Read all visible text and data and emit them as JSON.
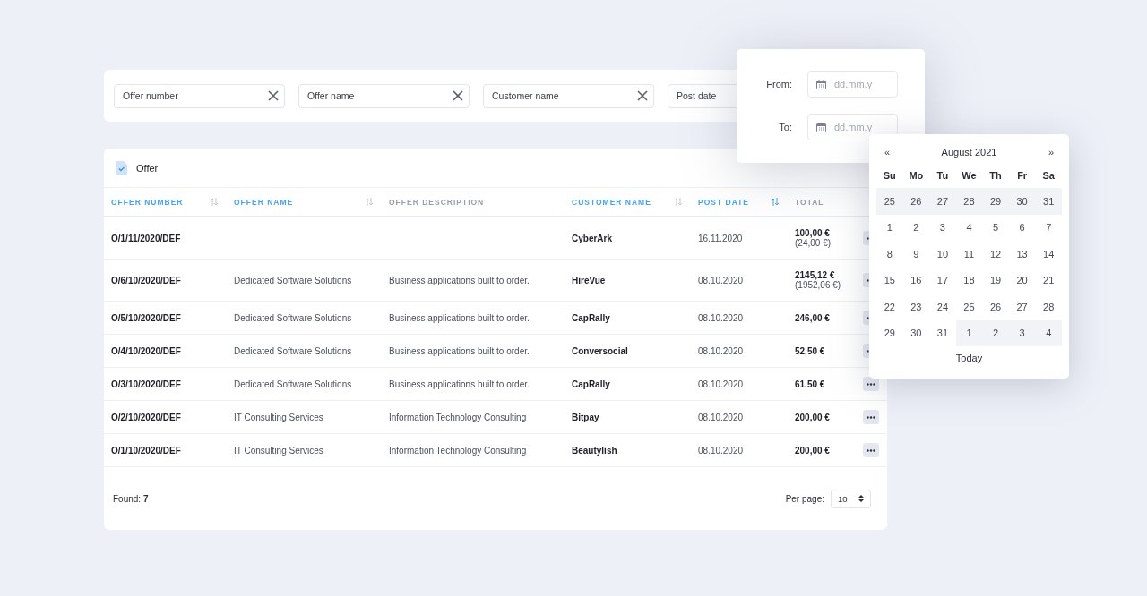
{
  "filters": [
    {
      "kind": "text",
      "placeholder": "Offer number"
    },
    {
      "kind": "text",
      "placeholder": "Offer name"
    },
    {
      "kind": "text",
      "placeholder": "Customer name"
    },
    {
      "kind": "date",
      "placeholder": "Post date"
    }
  ],
  "table": {
    "title": "Offer",
    "columns": [
      {
        "label": "OFFER NUMBER",
        "sortable": true,
        "sorted": false
      },
      {
        "label": "OFFER NAME",
        "sortable": true,
        "sorted": false
      },
      {
        "label": "OFFER DESCRIPTION",
        "sortable": false,
        "sorted": false
      },
      {
        "label": "CUSTOMER NAME",
        "sortable": true,
        "sorted": false
      },
      {
        "label": "POST DATE",
        "sortable": true,
        "sorted": true
      },
      {
        "label": "TOTAL",
        "sortable": false,
        "sorted": false
      }
    ],
    "rows": [
      {
        "number": "O/1/11/2020/DEF",
        "name": "",
        "description": "",
        "customer": "CyberArk",
        "date": "16.11.2020",
        "total": "100,00 €",
        "total_note": "(24,00 €)"
      },
      {
        "number": "O/6/10/2020/DEF",
        "name": "Dedicated Software Solutions",
        "description": "Business applications built to order.",
        "customer": "HireVue",
        "date": "08.10.2020",
        "total": "2145,12 €",
        "total_note": "(1952,06 €)"
      },
      {
        "number": "O/5/10/2020/DEF",
        "name": "Dedicated Software Solutions",
        "description": "Business applications built to order.",
        "customer": "CapRally",
        "date": "08.10.2020",
        "total": "246,00 €"
      },
      {
        "number": "O/4/10/2020/DEF",
        "name": "Dedicated Software Solutions",
        "description": "Business applications built to order.",
        "customer": "Conversocial",
        "date": "08.10.2020",
        "total": "52,50 €"
      },
      {
        "number": "O/3/10/2020/DEF",
        "name": "Dedicated Software Solutions",
        "description": "Business applications built to order.",
        "customer": "CapRally",
        "date": "08.10.2020",
        "total": "61,50 €"
      },
      {
        "number": "O/2/10/2020/DEF",
        "name": "IT Consulting Services",
        "description": "Information Technology Consulting",
        "customer": "Bitpay",
        "date": "08.10.2020",
        "total": "200,00 €"
      },
      {
        "number": "O/1/10/2020/DEF",
        "name": "IT Consulting Services",
        "description": "Information Technology Consulting",
        "customer": "Beautylish",
        "date": "08.10.2020",
        "total": "200,00 €"
      }
    ],
    "found": "Found: **7**",
    "per_page_label": "Per page:",
    "per_page": "10"
  },
  "date_filter": {
    "fields": [
      {
        "label": "From:",
        "placeholder": "dd.mm.y"
      },
      {
        "label": "To:",
        "placeholder": "dd.mm.y"
      }
    ]
  },
  "calendar": {
    "prev": "«",
    "title": "August 2021",
    "next": "»",
    "weekdays": [
      "Su",
      "Mo",
      "Tu",
      "We",
      "Th",
      "Fr",
      "Sa"
    ],
    "weeks": [
      [
        {
          "day": "25",
          "outside": true
        },
        {
          "day": "26",
          "outside": true
        },
        {
          "day": "27",
          "outside": true
        },
        {
          "day": "28",
          "outside": true
        },
        {
          "day": "29",
          "outside": true
        },
        {
          "day": "30",
          "outside": true
        },
        {
          "day": "31",
          "outside": true
        }
      ],
      [
        {
          "day": "1",
          "outside": false
        },
        {
          "day": "2",
          "outside": false
        },
        {
          "day": "3",
          "outside": false
        },
        {
          "day": "4",
          "outside": false
        },
        {
          "day": "5",
          "outside": false
        },
        {
          "day": "6",
          "outside": false
        },
        {
          "day": "7",
          "outside": false
        }
      ],
      [
        {
          "day": "8",
          "outside": false
        },
        {
          "day": "9",
          "outside": false
        },
        {
          "day": "10",
          "outside": false
        },
        {
          "day": "11",
          "outside": false
        },
        {
          "day": "12",
          "outside": false
        },
        {
          "day": "13",
          "outside": false
        },
        {
          "day": "14",
          "outside": false
        }
      ],
      [
        {
          "day": "15",
          "outside": false
        },
        {
          "day": "16",
          "outside": false
        },
        {
          "day": "17",
          "outside": false
        },
        {
          "day": "18",
          "outside": false
        },
        {
          "day": "19",
          "outside": false
        },
        {
          "day": "20",
          "outside": false
        },
        {
          "day": "21",
          "outside": false
        }
      ],
      [
        {
          "day": "22",
          "outside": false
        },
        {
          "day": "23",
          "outside": false
        },
        {
          "day": "24",
          "outside": false
        },
        {
          "day": "25",
          "outside": false
        },
        {
          "day": "26",
          "outside": false
        },
        {
          "day": "27",
          "outside": false
        },
        {
          "day": "28",
          "outside": false
        }
      ],
      [
        {
          "day": "29",
          "outside": false
        },
        {
          "day": "30",
          "outside": false
        },
        {
          "day": "31",
          "outside": false
        },
        {
          "day": "1",
          "outside": true
        },
        {
          "day": "2",
          "outside": true
        },
        {
          "day": "3",
          "outside": true
        },
        {
          "day": "4",
          "outside": true
        }
      ]
    ],
    "today": "Today"
  }
}
